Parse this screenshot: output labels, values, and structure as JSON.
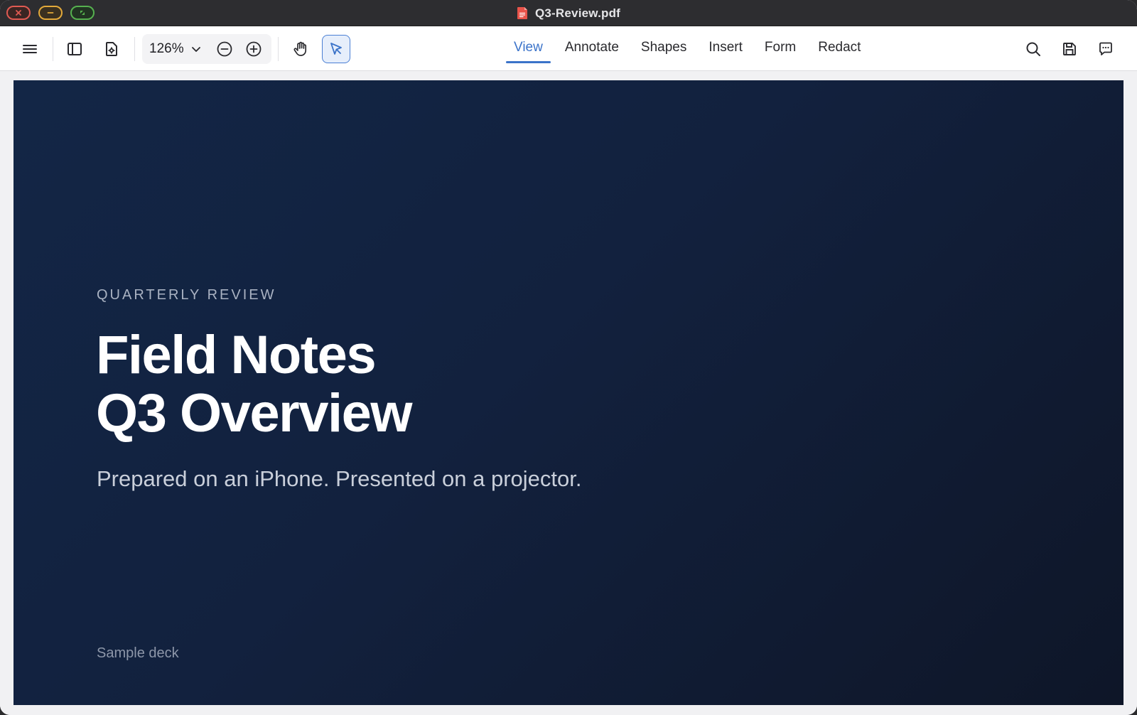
{
  "window": {
    "title": "Q3-Review.pdf",
    "file_icon": "pdf-file-icon"
  },
  "toolbar": {
    "zoom": {
      "value": "126%"
    },
    "tabs": [
      {
        "label": "View",
        "active": true
      },
      {
        "label": "Annotate",
        "active": false
      },
      {
        "label": "Shapes",
        "active": false
      },
      {
        "label": "Insert",
        "active": false
      },
      {
        "label": "Form",
        "active": false
      },
      {
        "label": "Redact",
        "active": false
      }
    ],
    "icons": {
      "menu": "hamburger-menu-icon",
      "sidebar": "sidebar-panel-icon",
      "document": "document-settings-icon",
      "zoom_out": "zoom-out-icon",
      "zoom_in": "zoom-in-icon",
      "hand": "hand-tool-icon",
      "select": "arrow-select-icon",
      "search": "search-icon",
      "save": "save-icon",
      "comment": "comment-icon"
    },
    "accent_color": "#3b73c9"
  },
  "slide": {
    "eyebrow": "QUARTERLY REVIEW",
    "headline_line1": "Field Notes",
    "headline_line2": "Q3 Overview",
    "subtitle": "Prepared on an iPhone. Presented on a projector.",
    "footer_note": "Sample deck",
    "background_color": "#12213e"
  }
}
